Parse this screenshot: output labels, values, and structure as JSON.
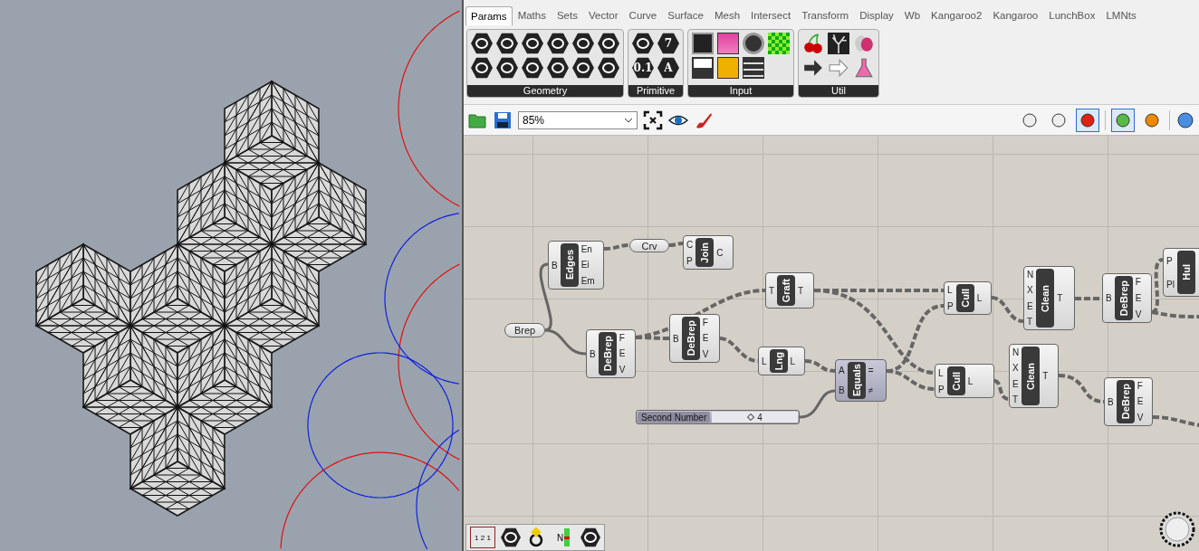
{
  "tabs": [
    {
      "label": "Params",
      "selected": true
    },
    {
      "label": "Maths",
      "selected": false
    },
    {
      "label": "Sets",
      "selected": false
    },
    {
      "label": "Vector",
      "selected": false
    },
    {
      "label": "Curve",
      "selected": false
    },
    {
      "label": "Surface",
      "selected": false
    },
    {
      "label": "Mesh",
      "selected": false
    },
    {
      "label": "Intersect",
      "selected": false
    },
    {
      "label": "Transform",
      "selected": false
    },
    {
      "label": "Display",
      "selected": false
    },
    {
      "label": "Wb",
      "selected": false
    },
    {
      "label": "Kangaroo2",
      "selected": false
    },
    {
      "label": "Kangaroo",
      "selected": false
    },
    {
      "label": "LunchBox",
      "selected": false
    },
    {
      "label": "LMNts",
      "selected": false
    }
  ],
  "ribbon": {
    "groups": [
      {
        "label": "Geometry"
      },
      {
        "label": "Primitive",
        "glyphs": [
          "0.1",
          "7",
          "A"
        ]
      },
      {
        "label": "Input"
      },
      {
        "label": "Util"
      }
    ]
  },
  "toolbar": {
    "zoom": "85%",
    "preview_modes": [
      {
        "selected": false
      },
      {
        "selected": false
      },
      {
        "selected": true
      }
    ],
    "display_modes": [
      {
        "selected": true
      },
      {
        "selected": false
      }
    ]
  },
  "nodes": [
    {
      "kind": "param",
      "title": "Brep"
    },
    {
      "kind": "component",
      "title": "Edges",
      "inputs": [
        "B"
      ],
      "outputs": [
        "En",
        "Ei",
        "Em"
      ]
    },
    {
      "kind": "param",
      "title": "Crv"
    },
    {
      "kind": "component",
      "title": "Join",
      "inputs": [
        "C",
        "P"
      ],
      "outputs": [
        "C"
      ]
    },
    {
      "kind": "component",
      "title": "DeBrep",
      "inputs": [
        "B"
      ],
      "outputs": [
        "F",
        "E",
        "V"
      ]
    },
    {
      "kind": "component",
      "title": "DeBrep",
      "inputs": [
        "B"
      ],
      "outputs": [
        "F",
        "E",
        "V"
      ]
    },
    {
      "kind": "component",
      "title": "Graft",
      "inputs": [
        "T"
      ],
      "outputs": [
        "T"
      ]
    },
    {
      "kind": "component",
      "title": "Lng",
      "inputs": [
        "L"
      ],
      "outputs": [
        "L"
      ]
    },
    {
      "kind": "component",
      "title": "Equals",
      "inputs": [
        "A",
        "B"
      ],
      "outputs": [
        "=",
        "≠"
      ],
      "highlighted": true
    },
    {
      "kind": "slider",
      "title": "Second Number",
      "value": "4",
      "highlighted": true
    },
    {
      "kind": "component",
      "title": "Cull",
      "inputs": [
        "L",
        "P"
      ],
      "outputs": [
        "L"
      ]
    },
    {
      "kind": "component",
      "title": "Cull",
      "inputs": [
        "L",
        "P"
      ],
      "outputs": [
        "L"
      ]
    },
    {
      "kind": "component",
      "title": "Clean",
      "inputs": [
        "N",
        "X",
        "E",
        "T"
      ],
      "outputs": [
        "T"
      ]
    },
    {
      "kind": "component",
      "title": "Clean",
      "inputs": [
        "N",
        "X",
        "E",
        "T"
      ],
      "outputs": [
        "T"
      ]
    },
    {
      "kind": "component",
      "title": "DeBrep",
      "inputs": [
        "B"
      ],
      "outputs": [
        "F",
        "E",
        "V"
      ]
    },
    {
      "kind": "component",
      "title": "DeBrep",
      "inputs": [
        "B"
      ],
      "outputs": [
        "F",
        "E",
        "V"
      ]
    },
    {
      "kind": "component",
      "title": "Hul",
      "inputs": [
        "P",
        "Pl"
      ]
    }
  ],
  "bottom_toolbar": {
    "labels": [
      "1 2 1",
      "N"
    ]
  }
}
